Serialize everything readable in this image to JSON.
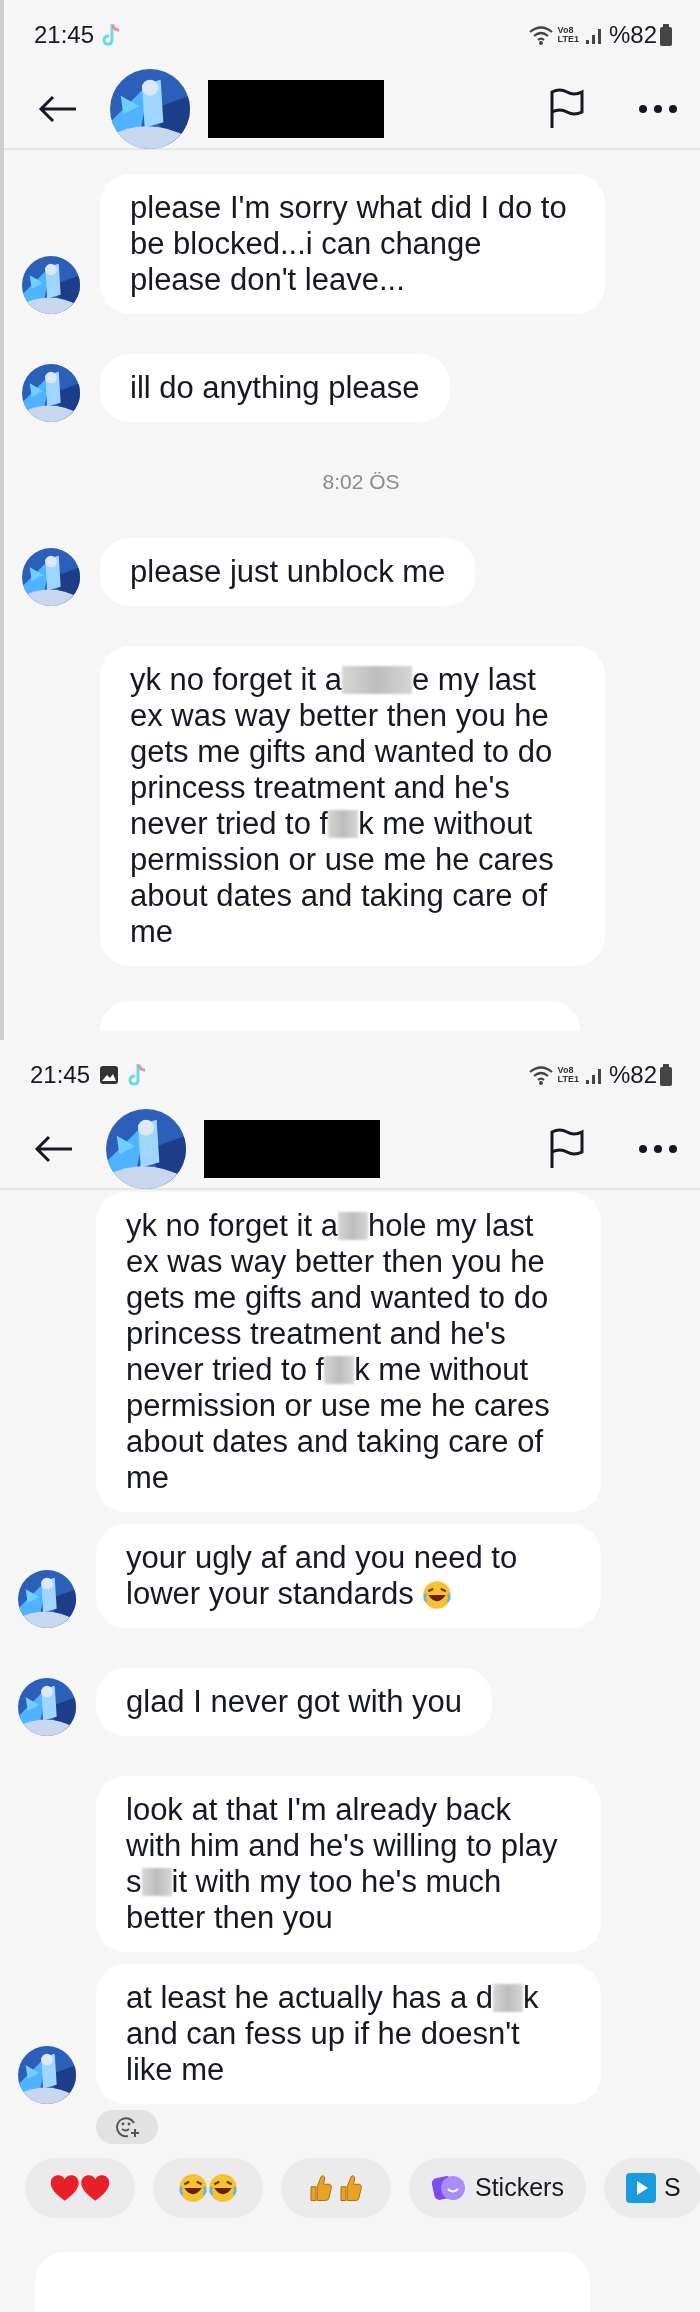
{
  "screens": [
    {
      "status_bar": {
        "time": "21:45",
        "gallery_notification": false,
        "volte": [
          "Vo8",
          "LTE1"
        ],
        "battery": "%82"
      },
      "messages": [
        {
          "kind": "bubble",
          "avatar": true,
          "segments": [
            {
              "kind": "text",
              "text": "please I'm sorry what did I do to be blocked...i can change please don't leave..."
            }
          ]
        },
        {
          "kind": "bubble",
          "avatar": true,
          "segments": [
            {
              "kind": "text",
              "text": "ill do anything please"
            }
          ]
        },
        {
          "kind": "time",
          "text": "8:02 ÖS"
        },
        {
          "kind": "bubble",
          "avatar": true,
          "segments": [
            {
              "kind": "text",
              "text": "please just unblock me"
            }
          ]
        },
        {
          "kind": "bubble",
          "avatar": false,
          "segments": [
            {
              "kind": "text",
              "text": "yk no forget it a"
            },
            {
              "kind": "censor_wide"
            },
            {
              "kind": "text",
              "text": "e my last ex was way better then you he gets me gifts and wanted to do princess treatment and he's never tried to f"
            },
            {
              "kind": "censor"
            },
            {
              "kind": "text",
              "text": "k me without permission or use me he cares about dates and taking care of me"
            }
          ]
        },
        {
          "kind": "partial",
          "avatar": false
        }
      ]
    },
    {
      "status_bar": {
        "time": "21:45",
        "gallery_notification": true,
        "volte": [
          "Vo8",
          "LTE1"
        ],
        "battery": "%82"
      },
      "messages": [
        {
          "kind": "bubble",
          "avatar": false,
          "segments": [
            {
              "kind": "text",
              "text": "yk no forget it a"
            },
            {
              "kind": "censor"
            },
            {
              "kind": "text",
              "text": "hole my last ex was way better then you he gets me gifts and wanted to do princess treatment and he's never tried to f"
            },
            {
              "kind": "censor"
            },
            {
              "kind": "text",
              "text": "k me without permission or use me he cares about dates and taking care of me"
            }
          ]
        },
        {
          "kind": "bubble",
          "avatar": true,
          "segments": [
            {
              "kind": "text",
              "text": "your ugly af and you need to lower your standards"
            },
            {
              "kind": "emoji"
            }
          ]
        },
        {
          "kind": "bubble",
          "avatar": true,
          "segments": [
            {
              "kind": "text",
              "text": "glad I never got with you"
            }
          ]
        },
        {
          "kind": "bubble",
          "avatar": false,
          "segments": [
            {
              "kind": "text",
              "text": "look at that I'm already back with him and he's willing to play s"
            },
            {
              "kind": "censor"
            },
            {
              "kind": "text",
              "text": "it with my too he's much better then you"
            }
          ]
        },
        {
          "kind": "bubble",
          "avatar": true,
          "reaction_button": true,
          "segments": [
            {
              "kind": "text",
              "text": "at least he actually has a d"
            },
            {
              "kind": "censor"
            },
            {
              "kind": "text",
              "text": "k and can fess up if he doesn't like me"
            }
          ]
        }
      ],
      "quick_replies": [
        {
          "kind": "hearts"
        },
        {
          "kind": "laughs"
        },
        {
          "kind": "thumbs"
        },
        {
          "kind": "stickers",
          "label": "Stickers"
        },
        {
          "kind": "video",
          "label": "S"
        }
      ]
    }
  ]
}
